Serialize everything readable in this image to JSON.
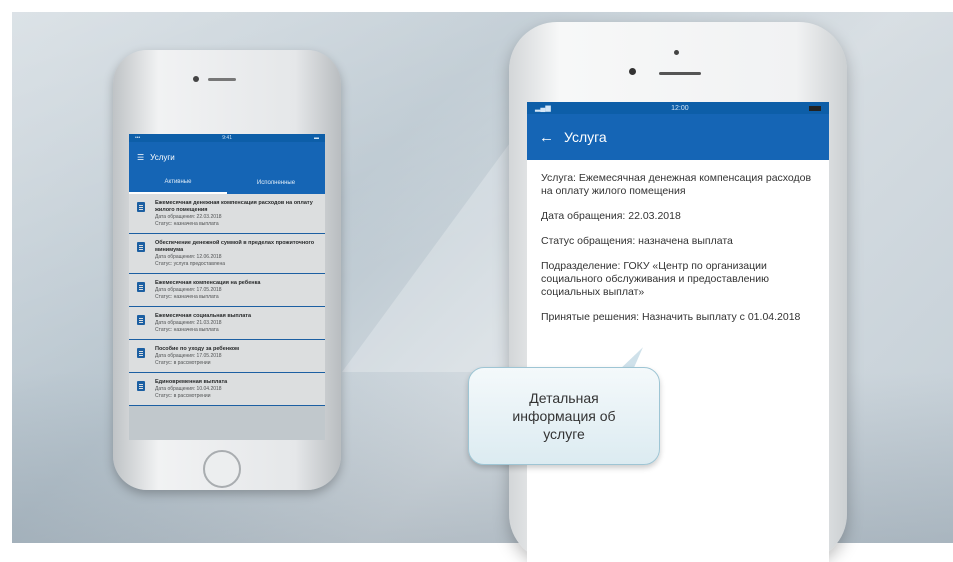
{
  "small_phone": {
    "status_time": "9:41",
    "app_title": "Услуги",
    "tabs": [
      "Активные",
      "Исполненные"
    ],
    "items": [
      {
        "title": "Ежемесячная денежная компенсация расходов на оплату жилого помещения",
        "date": "Дата обращения: 22.03.2018",
        "status": "Статус: назначена выплата"
      },
      {
        "title": "Обеспечение денежной суммой в пределах прожиточного минимума",
        "date": "Дата обращения: 12.06.2018",
        "status": "Статус: услуга предоставлена"
      },
      {
        "title": "Ежемесячная компенсация на ребенка",
        "date": "Дата обращения: 17.05.2018",
        "status": "Статус: назначена выплата"
      },
      {
        "title": "Ежемесячная социальная выплата",
        "date": "Дата обращения: 21.03.2018",
        "status": "Статус: назначена выплата"
      },
      {
        "title": "Пособие по уходу за ребенком",
        "date": "Дата обращения: 17.05.2018",
        "status": "Статус: в рассмотрении"
      },
      {
        "title": "Единовременная выплата",
        "date": "Дата обращения: 10.04.2018",
        "status": "Статус: в рассмотрении"
      }
    ]
  },
  "large_phone": {
    "status_carrier": "📶",
    "status_time": "12:00",
    "title": "Услуга",
    "back_icon": "arrow-left",
    "rows": [
      "Услуга: Ежемесячная денежная компенсация расходов на оплату жилого помещения",
      "Дата обращения: 22.03.2018",
      "Статус обращения: назначена выплата",
      "Подразделение: ГОКУ «Центр по организации социального обслуживания и предоставлению социальных выплат»",
      "Принятые решения: Назначить выплату с 01.04.2018"
    ]
  },
  "callout": {
    "text": "Детальная\nинформация об\nуслуге"
  }
}
